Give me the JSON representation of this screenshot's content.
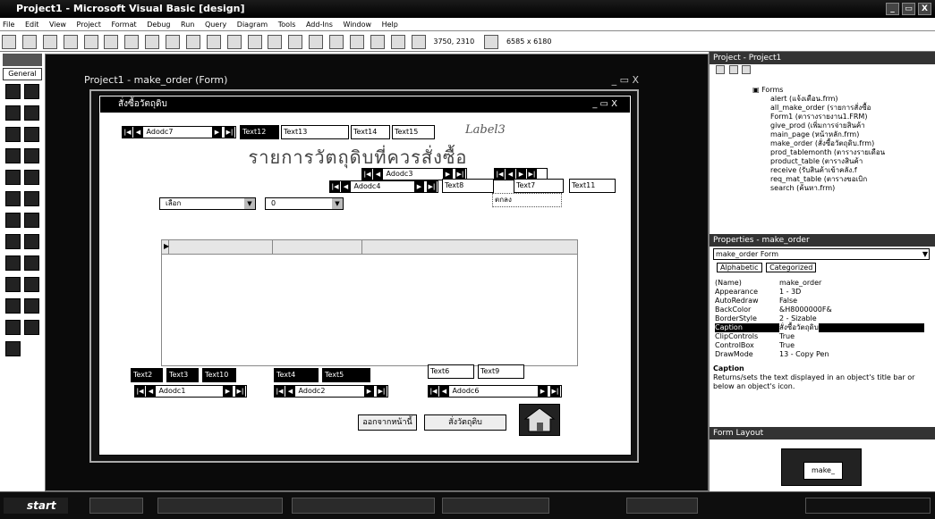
{
  "app": {
    "title": "Project1 - Microsoft Visual Basic [design]",
    "window_controls": [
      "_",
      "▭",
      "X"
    ]
  },
  "menu": [
    "File",
    "Edit",
    "View",
    "Project",
    "Format",
    "Debug",
    "Run",
    "Query",
    "Diagram",
    "Tools",
    "Add-Ins",
    "Window",
    "Help"
  ],
  "toolbar": {
    "position": "3750, 2310",
    "size": "6585 x 6180"
  },
  "toolbox": {
    "title": "",
    "group": "General"
  },
  "mdi": {
    "title": "Project1 - make_order (Form)"
  },
  "form": {
    "caption": "สั่งซื้อวัตถุดิบ",
    "heading": "รายการวัตถุดิบที่ควรสั่งซื้อ",
    "label": "Label3",
    "controls": {
      "adodc7": "Adodc7",
      "text12": "Text12",
      "text13": "Text13",
      "text14": "Text14",
      "text15": "Text15",
      "adodc3": "Adodc3",
      "adodc_mid": "Adodc4",
      "text8": "Text8",
      "text7": "Text7",
      "text11": "Text11",
      "label_small": "ตกลง",
      "combo1": "เลือก",
      "combo2": "0",
      "text2": "Text2",
      "text3": "Text3",
      "text10": "Text10",
      "text4": "Text4",
      "text5": "Text5",
      "text6": "Text6",
      "text9": "Text9",
      "adodc1": "Adodc1",
      "adodc2": "Adodc2",
      "adodc6": "Adodc6",
      "btn_back": "ออกจากหน้านี้",
      "btn_order": "สั่งวัตถุดิบ"
    }
  },
  "project_explorer": {
    "title": "Project - Project1",
    "folder": "Forms",
    "items": [
      "alert (แจ้งเตือน.frm)",
      "all_make_order (รายการสั่งซื้อ",
      "Form1 (ตารางรายงาน1.FRM)",
      "give_prod (เพิ่มการจ่ายสินค้า",
      "main_page (หน้าหลัก.frm)",
      "make_order (สั่งซื้อวัตถุดิบ.frm)",
      "prod_tablemonth (ตารางรายเดือน",
      "product_table (ตารางสินค้า",
      "receive (รับสินค้าเข้าคลัง.f",
      "req_mat_table (ตารางขอเบิก",
      "search (ค้นหา.frm)"
    ]
  },
  "properties": {
    "title": "Properties - make_order",
    "object": "make_order Form",
    "tabs": [
      "Alphabetic",
      "Categorized"
    ],
    "rows": [
      {
        "name": "(Name)",
        "value": "make_order"
      },
      {
        "name": "Appearance",
        "value": "1 - 3D"
      },
      {
        "name": "AutoRedraw",
        "value": "False"
      },
      {
        "name": "BackColor",
        "value": "&H8000000F&"
      },
      {
        "name": "BorderStyle",
        "value": "2 - Sizable"
      },
      {
        "name": "Caption",
        "value": "สั่งซื้อวัตถุดิบ"
      },
      {
        "name": "ClipControls",
        "value": "True"
      },
      {
        "name": "ControlBox",
        "value": "True"
      },
      {
        "name": "DrawMode",
        "value": "13 - Copy Pen"
      }
    ],
    "desc_title": "Caption",
    "desc_text": "Returns/sets the text displayed in an object's title bar or below an object's icon."
  },
  "form_layout": {
    "title": "Form Layout",
    "thumb": "make_"
  },
  "taskbar": {
    "start": "start"
  },
  "colors": {
    "title_bg": "#000000",
    "form_bg": "#ffffff",
    "workspace_bg": "#0a0a0a"
  }
}
